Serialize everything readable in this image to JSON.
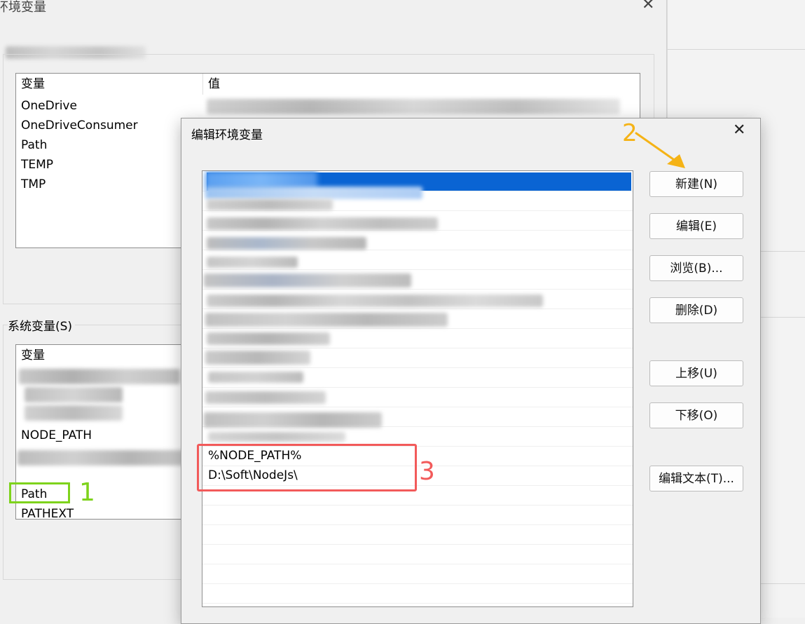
{
  "bg_dialog": {
    "title": "环境变量",
    "close_glyph": "✕",
    "user_vars": {
      "col_variable": "变量",
      "col_value": "值",
      "rows": [
        "OneDrive",
        "OneDriveConsumer",
        "Path",
        "TEMP",
        "TMP"
      ]
    },
    "system_vars": {
      "label": "系统变量(S)",
      "col_variable": "变量",
      "rows": [
        "NODE_PATH",
        "Path",
        "PATHEXT"
      ]
    }
  },
  "edit_dialog": {
    "title": "编辑环境变量",
    "close_glyph": "✕",
    "entries": [
      "%NODE_PATH%",
      "D:\\Soft\\NodeJs\\"
    ],
    "buttons": {
      "new": "新建(N)",
      "edit": "编辑(E)",
      "browse": "浏览(B)...",
      "delete": "删除(D)",
      "move_up": "上移(U)",
      "move_down": "下移(O)",
      "edit_text": "编辑文本(T)..."
    }
  },
  "annotations": {
    "label_1": "1",
    "label_2": "2",
    "label_3": "3",
    "color_green": "#7ed31c",
    "color_red": "#f25a5a",
    "color_orange": "#f5b316"
  },
  "colors": {
    "selection": "#0a64d3",
    "dialog_bg": "#f0f0f0"
  }
}
